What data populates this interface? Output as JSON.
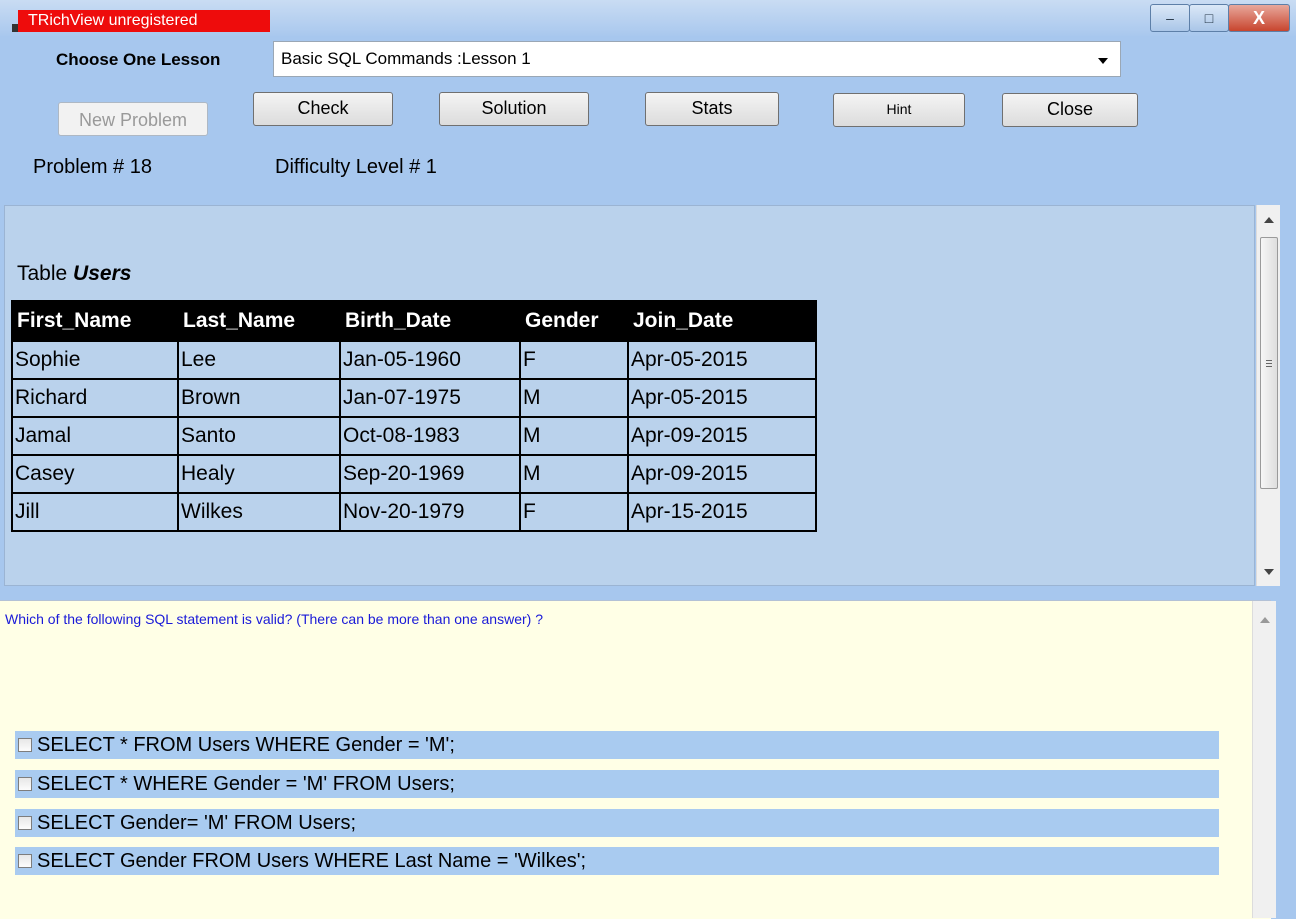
{
  "window": {
    "badge": "TRichView unregistered",
    "controls": {
      "minimize": "–",
      "maximize": "□",
      "close": "X"
    }
  },
  "lesson": {
    "label": "Choose One Lesson",
    "selected": "Basic SQL Commands :Lesson 1"
  },
  "buttons": {
    "new_problem": "New Problem",
    "check": "Check",
    "solution": "Solution",
    "stats": "Stats",
    "hint": "Hint",
    "close": "Close"
  },
  "problem": {
    "number": "Problem # 18",
    "difficulty": "Difficulty Level # 1"
  },
  "table": {
    "title_prefix": "Table ",
    "name": "Users",
    "columns": [
      "First_Name",
      "Last_Name",
      "Birth_Date",
      "Gender",
      "Join_Date"
    ],
    "rows": [
      [
        "Sophie",
        "Lee",
        "Jan-05-1960",
        "F",
        "Apr-05-2015"
      ],
      [
        "Richard",
        "Brown",
        "Jan-07-1975",
        "M",
        "Apr-05-2015"
      ],
      [
        "Jamal",
        "Santo",
        "Oct-08-1983",
        "M",
        "Apr-09-2015"
      ],
      [
        "Casey",
        "Healy",
        "Sep-20-1969",
        "M",
        "Apr-09-2015"
      ],
      [
        "Jill",
        "Wilkes",
        "Nov-20-1979",
        "F",
        "Apr-15-2015"
      ]
    ]
  },
  "question": {
    "text": "Which of the following SQL statement is valid? (There can be more than one answer) ?",
    "options": [
      "SELECT * FROM Users WHERE Gender = 'M';",
      "SELECT * WHERE Gender = 'M' FROM Users;",
      "SELECT Gender= 'M' FROM Users;",
      "SELECT Gender FROM Users WHERE Last  Name = 'Wilkes';"
    ]
  }
}
